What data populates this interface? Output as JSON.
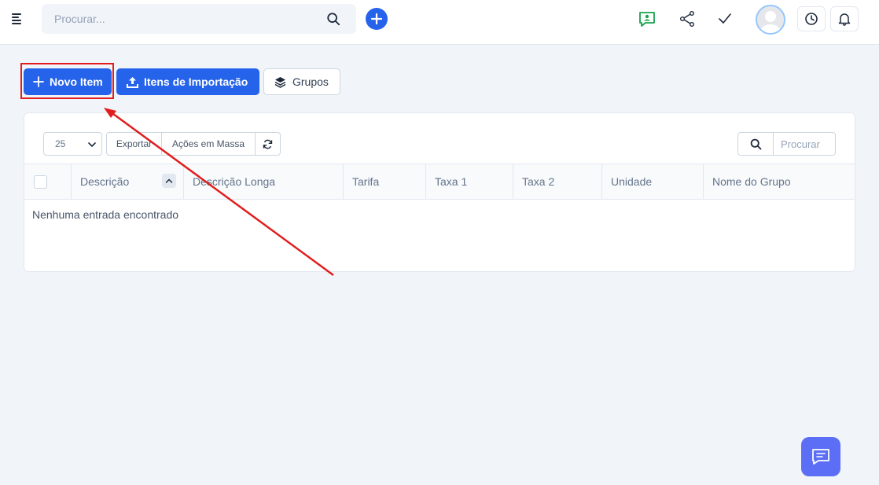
{
  "header": {
    "search_placeholder": "Procurar...",
    "icons": [
      "menu-icon",
      "search-icon",
      "plus-icon",
      "support-chat-icon",
      "share-icon",
      "check-icon",
      "user-avatar",
      "clock-icon",
      "bell-icon"
    ],
    "colors": {
      "accent": "#2563eb",
      "support_icon": "#16a34a"
    }
  },
  "actions": {
    "new_item": "Novo Item",
    "import_items": "Itens de Importação",
    "groups": "Grupos"
  },
  "table": {
    "page_length": "25",
    "export": "Exportar",
    "bulk_actions": "Ações em Massa",
    "search_placeholder": "Procurar",
    "columns": [
      "Descrição",
      "Descrição Longa",
      "Tarifa",
      "Taxa 1",
      "Taxa 2",
      "Unidade",
      "Nome do Grupo"
    ],
    "empty_message": "Nenhuma entrada encontrado"
  },
  "annotation": {
    "highlight_color": "#e11d1d"
  }
}
